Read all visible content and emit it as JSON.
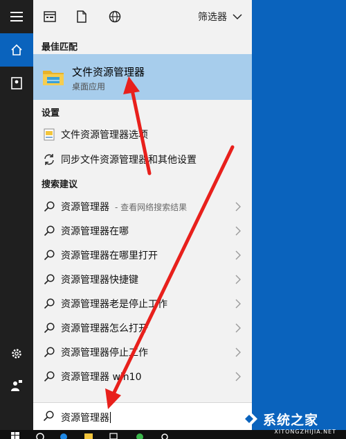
{
  "rail": {
    "icons": [
      "hamburger-icon",
      "home-icon",
      "notebook-icon",
      "settings-icon",
      "user-feedback-icon"
    ]
  },
  "toolbar": {
    "icons": [
      "apps-icon",
      "documents-icon",
      "web-icon"
    ],
    "filter_label": "筛选器"
  },
  "best_match": {
    "heading": "最佳匹配",
    "title": "文件资源管理器",
    "subtitle": "桌面应用"
  },
  "settings": {
    "heading": "设置",
    "items": [
      {
        "label": "文件资源管理器选项",
        "icon": "folder-options-icon"
      },
      {
        "label": "同步文件资源管理器和其他设置",
        "icon": "sync-icon"
      }
    ]
  },
  "suggestions": {
    "heading": "搜索建议",
    "items": [
      {
        "label": "资源管理器",
        "hint": "- 查看网络搜索结果"
      },
      {
        "label": "资源管理器在哪",
        "hint": ""
      },
      {
        "label": "资源管理器在哪里打开",
        "hint": ""
      },
      {
        "label": "资源管理器快捷键",
        "hint": ""
      },
      {
        "label": "资源管理器老是停止工作",
        "hint": ""
      },
      {
        "label": "资源管理器怎么打开",
        "hint": ""
      },
      {
        "label": "资源管理器停止工作",
        "hint": ""
      },
      {
        "label": "资源管理器 win10",
        "hint": ""
      }
    ]
  },
  "search": {
    "value": "资源管理器"
  },
  "watermark": {
    "name": "系统之家",
    "site": "XITONGZHIJIA.NET"
  },
  "colors": {
    "accent": "#0a63bd",
    "highlight": "#a7cdec",
    "panel": "#f2f2f2",
    "rail": "#1f1f1f",
    "arrow": "#e8201c"
  }
}
